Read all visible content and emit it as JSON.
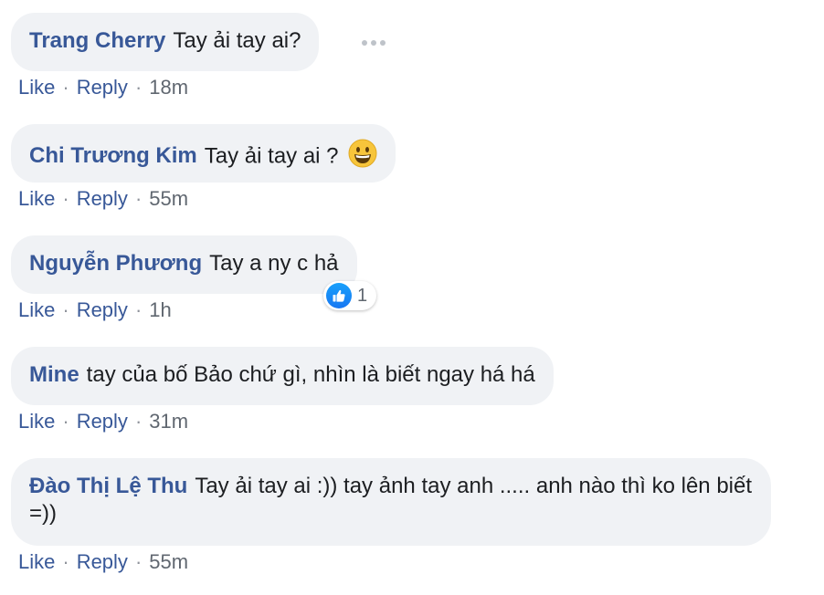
{
  "colors": {
    "name": "#385898",
    "bubble": "#f0f2f5",
    "meta": "#606770",
    "like_blue": "#1877f2"
  },
  "comments": [
    {
      "author": "Trang Cherry",
      "text": "Tay ải tay ai?",
      "actions": {
        "like": "Like",
        "reply": "Reply",
        "sep": "·",
        "time": "18m"
      }
    },
    {
      "author": "Chi Trương Kim",
      "text": "Tay ải tay ai ?",
      "emoji": "grinning-face-icon",
      "actions": {
        "like": "Like",
        "reply": "Reply",
        "sep": "·",
        "time": "55m"
      }
    },
    {
      "author": "Nguyễn Phương",
      "text": "Tay a ny c hả",
      "reaction": {
        "icon": "thumbs-up-icon",
        "count": "1"
      },
      "actions": {
        "like": "Like",
        "reply": "Reply",
        "sep": "·",
        "time": "1h"
      }
    },
    {
      "author": "Mine",
      "text": "tay của bố Bảo chứ gì, nhìn là biết ngay há há",
      "actions": {
        "like": "Like",
        "reply": "Reply",
        "sep": "·",
        "time": "31m"
      }
    },
    {
      "author": "Đào Thị Lệ Thu",
      "text": "Tay ải tay ai :)) tay ảnh tay anh ..... anh nào thì ko lên biết =))",
      "actions": {
        "like": "Like",
        "reply": "Reply",
        "sep": "·",
        "time": "55m"
      }
    }
  ]
}
